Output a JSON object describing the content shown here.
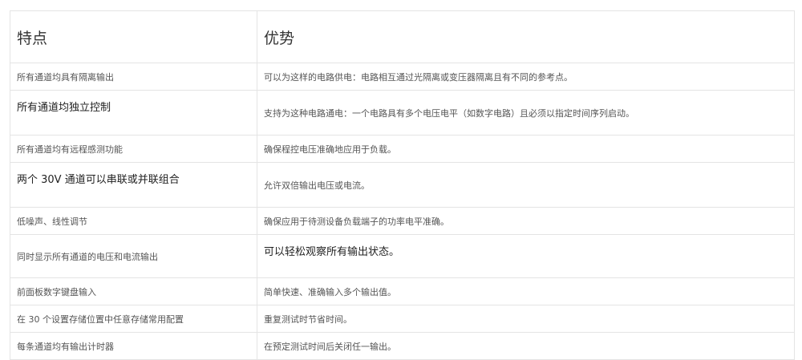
{
  "table": {
    "headers": [
      "特点",
      "优势"
    ],
    "rows": [
      {
        "feature": "所有通道均具有隔离输出",
        "benefit": "可以为这样的电路供电：电路相互通过光隔离或变压器隔离且有不同的参考点。"
      },
      {
        "feature": "所有通道均独立控制",
        "benefit": "支持为这种电路通电：一个电路具有多个电压电平（如数字电路）且必须以指定时间序列启动。"
      },
      {
        "feature": "所有通道均有远程感测功能",
        "benefit": "确保程控电压准确地应用于负载。"
      },
      {
        "feature": "两个 30V 通道可以串联或并联组合",
        "benefit": "允许双倍输出电压或电流。"
      },
      {
        "feature": "低噪声、线性调节",
        "benefit": "确保应用于待测设备负载端子的功率电平准确。"
      },
      {
        "feature": "同时显示所有通道的电压和电流输出",
        "benefit": "可以轻松观察所有输出状态。"
      },
      {
        "feature": "前面板数字键盘输入",
        "benefit": "简单快速、准确输入多个输出值。"
      },
      {
        "feature": "在 30 个设置存储位置中任意存储常用配置",
        "benefit": "重复测试时节省时间。"
      },
      {
        "feature": "每条通道均有输出计时器",
        "benefit": "在预定测试时间后关闭任一输出。"
      }
    ]
  }
}
